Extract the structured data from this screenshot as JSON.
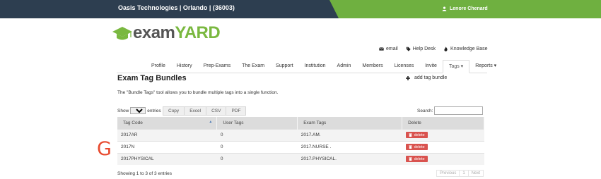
{
  "header": {
    "org": "Oasis Technologies | Orlando | (36003)",
    "user": "Lenore Chenard"
  },
  "logo": {
    "part1": "exam",
    "part2": "YARD"
  },
  "utility_links": [
    {
      "label": "email",
      "icon": "envelope-icon"
    },
    {
      "label": "Help Desk",
      "icon": "tag-icon"
    },
    {
      "label": "Knowledge Base",
      "icon": "fire-icon"
    }
  ],
  "nav": [
    {
      "label": "Profile"
    },
    {
      "label": "History"
    },
    {
      "label": "Prep-Exams"
    },
    {
      "label": "The Exam"
    },
    {
      "label": "Support"
    },
    {
      "label": "Institution"
    },
    {
      "label": "Admin"
    },
    {
      "label": "Members"
    },
    {
      "label": "Licenses"
    },
    {
      "label": "Invite"
    },
    {
      "label": "Tags ▾",
      "active": true
    },
    {
      "label": "Reports ▾"
    }
  ],
  "page": {
    "title": "Exam Tag Bundles",
    "add_label": "add tag bundle",
    "description": "The \"Bundle Tags\" tool allows you to bundle multiple tags into a single function."
  },
  "controls": {
    "show_label": "Show",
    "show_value": "10",
    "entries_label": "entries",
    "export_buttons": [
      "Copy",
      "Excel",
      "CSV",
      "PDF"
    ],
    "search_label": "Search:"
  },
  "table": {
    "columns": [
      "Tag Code",
      "User Tags",
      "Exam Tags",
      "Delete"
    ],
    "rows": [
      {
        "code": "2017AR",
        "user_tags": "0",
        "exam_tags": "2017.AM.",
        "delete": "delete"
      },
      {
        "code": "2017N",
        "user_tags": "0",
        "exam_tags": "2017.NURSE .",
        "delete": "delete"
      },
      {
        "code": "2017PHYSICAL",
        "user_tags": "0",
        "exam_tags": "2017.PHYSICAL.",
        "delete": "delete"
      }
    ]
  },
  "footer": {
    "info": "Showing 1 to 3 of 3 entries",
    "pager": [
      "Previous",
      "1",
      "Next"
    ]
  },
  "overlay_letter": "G",
  "colors": {
    "topbar": "#2d3e50",
    "accent_green": "#6fb040",
    "delete_red": "#d9534f",
    "overlay_red": "#e84a2f"
  }
}
